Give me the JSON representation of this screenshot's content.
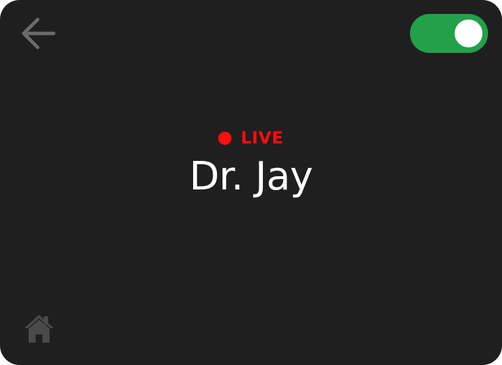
{
  "icons": {
    "back": "arrow-left-icon",
    "home": "home-icon"
  },
  "toggle": {
    "state": "on",
    "color": "#22a04a"
  },
  "status": {
    "label": "LIVE",
    "color": "#ff0d0d"
  },
  "main": {
    "title": "Dr. Jay"
  },
  "colors": {
    "background": "#1f1f1f",
    "icon": "#6b6b6b",
    "home_icon": "#4a4a4a",
    "text": "#ffffff"
  }
}
